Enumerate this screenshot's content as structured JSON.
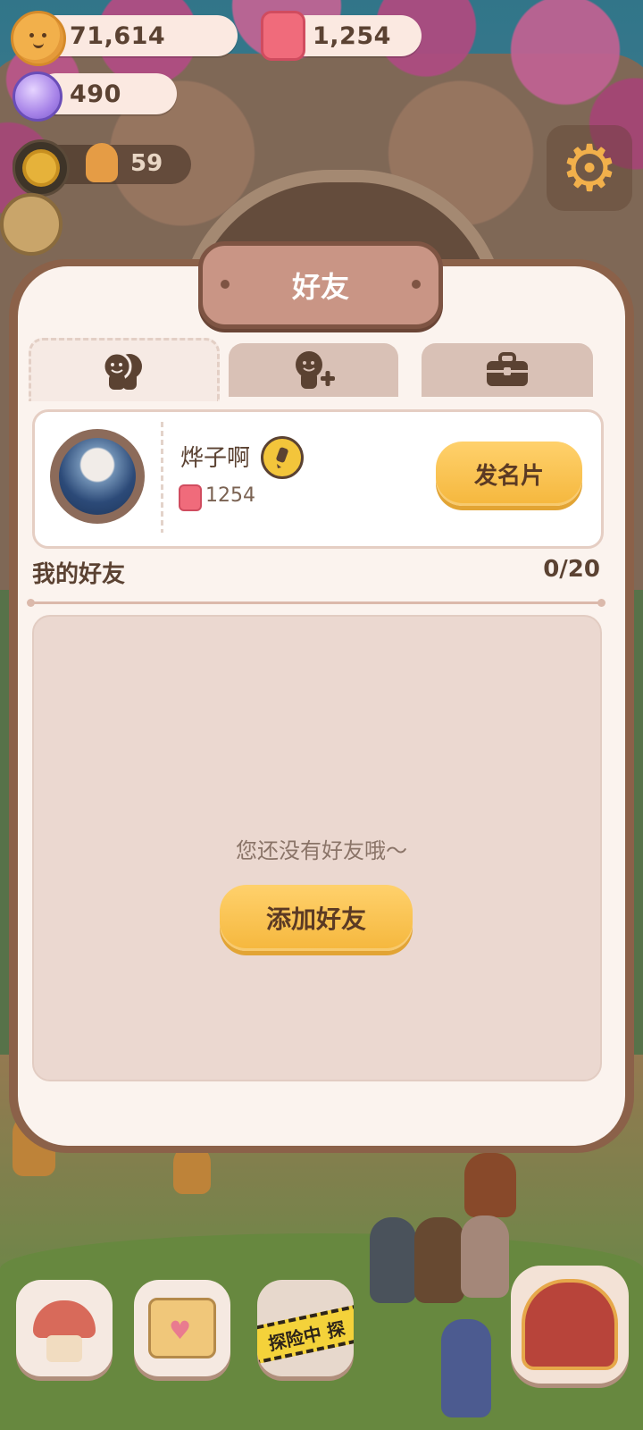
{
  "currency": {
    "cookies": "71,614",
    "jam": "1,254",
    "gems": "490",
    "level": "59"
  },
  "icons": {
    "cookie": "cookie-icon",
    "jam": "jam-icon",
    "gem": "gem-icon",
    "settings": "gear-icon",
    "friends_tab": "friends-icon",
    "add_friend_tab": "add-friend-icon",
    "gift_tab": "briefcase-icon",
    "badge": "badge-icon"
  },
  "modal": {
    "title": "好友",
    "tabs": [
      {
        "name": "friends-list",
        "active": true
      },
      {
        "name": "add-friend",
        "active": false
      },
      {
        "name": "inbox",
        "active": false
      }
    ],
    "profile": {
      "name": "烨子啊",
      "jam_count": "1254",
      "send_card_label": "发名片"
    },
    "friends_section": {
      "title": "我的好友",
      "count": "0/20",
      "empty_message": "您还没有好友哦～",
      "add_friend_label": "添加好友"
    }
  },
  "bottom_nav": {
    "adventure_tape": "探险中 探"
  },
  "colors": {
    "accent_yellow": "#f5b73d",
    "modal_bg": "#fbf3ee",
    "title_plate": "#c99585",
    "text_brown": "#5b4232"
  }
}
